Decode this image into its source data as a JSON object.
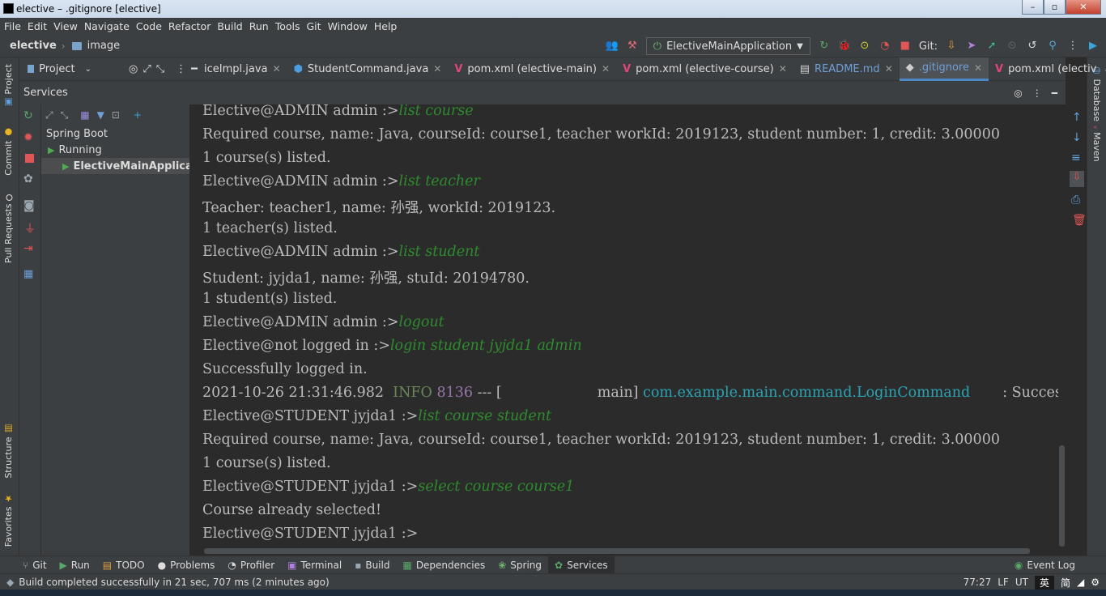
{
  "window": {
    "title": "elective – .gitignore [elective]",
    "min": "–",
    "max": "▫",
    "close": "✕"
  },
  "menu": [
    "File",
    "Edit",
    "View",
    "Navigate",
    "Code",
    "Refactor",
    "Build",
    "Run",
    "Tools",
    "Git",
    "Window",
    "Help"
  ],
  "breadcrumb": {
    "project": "elective",
    "folder": "image"
  },
  "run_config": {
    "label": "ElectiveMainApplication"
  },
  "git_label": "Git:",
  "project_tab": {
    "label": "Project"
  },
  "editor_tabs": [
    {
      "label": "iceImpl.java",
      "icon": "java-class-icon",
      "active": false
    },
    {
      "label": "StudentCommand.java",
      "icon": "java-class-icon",
      "active": false
    },
    {
      "label": "pom.xml (elective-main)",
      "icon": "maven-icon",
      "active": false
    },
    {
      "label": "pom.xml (elective-course)",
      "icon": "maven-icon",
      "active": false
    },
    {
      "label": "README.md",
      "icon": "markdown-icon",
      "active": false
    },
    {
      "label": ".gitignore",
      "icon": "gitignore-icon",
      "active": true
    },
    {
      "label": "pom.xml (electiv",
      "icon": "maven-icon",
      "active": false
    }
  ],
  "left_strip": {
    "project": "Project",
    "commit": "Commit",
    "pull_requests": "Pull Requests",
    "structure": "Structure",
    "favorites": "Favorites"
  },
  "right_strip": {
    "database": "Database",
    "maven": "Maven"
  },
  "services": {
    "title": "Services",
    "tree": [
      {
        "label": "Spring Boot",
        "level": 0
      },
      {
        "label": "Running",
        "level": 1
      },
      {
        "label": "ElectiveMainApplicatio",
        "level": 2,
        "selected": true
      }
    ]
  },
  "console": {
    "lines": [
      {
        "prompt": "Elective@ADMIN admin :>",
        "cmd": "list course"
      },
      {
        "text": "Required course, name: Java, courseId: course1, teacher workId: 2019123, student number: 1, credit: 3.00000"
      },
      {
        "text": "1 course(s) listed."
      },
      {
        "prompt": "Elective@ADMIN admin :>",
        "cmd": "list teacher"
      },
      {
        "text": "Teacher: teacher1, name: 孙强, workId: 2019123."
      },
      {
        "text": "1 teacher(s) listed."
      },
      {
        "prompt": "Elective@ADMIN admin :>",
        "cmd": "list student"
      },
      {
        "text": "Student: jyjda1, name: 孙强, stuId: 20194780."
      },
      {
        "text": "1 student(s) listed."
      },
      {
        "prompt": "Elective@ADMIN admin :>",
        "cmd": "logout"
      },
      {
        "prompt": "Elective@not logged in :>",
        "cmd": "login student jyjda1 admin"
      },
      {
        "text": "Successfully logged in."
      },
      {
        "log": true,
        "ts": "2021-10-26 21:31:46.982",
        "level": "INFO",
        "pid": "8136",
        "sep": "--- [",
        "thread": "main]",
        "logger": "com.example.main.command.LoginCommand",
        "msg": ": Success"
      },
      {
        "prompt": "Elective@STUDENT jyjda1 :>",
        "cmd": "list course student"
      },
      {
        "text": "Required course, name: Java, courseId: course1, teacher workId: 2019123, student number: 1, credit: 3.00000"
      },
      {
        "text": "1 course(s) listed."
      },
      {
        "prompt": "Elective@STUDENT jyjda1 :>",
        "cmd": "select course course1"
      },
      {
        "text": "Course already selected!"
      },
      {
        "prompt": "Elective@STUDENT jyjda1 :>",
        "cmd": ""
      }
    ]
  },
  "bottom_tabs": [
    {
      "label": "Git",
      "icon": "git-branch-icon"
    },
    {
      "label": "Run",
      "icon": "run-icon"
    },
    {
      "label": "TODO",
      "icon": "todo-icon"
    },
    {
      "label": "Problems",
      "icon": "problems-icon"
    },
    {
      "label": "Profiler",
      "icon": "profiler-icon"
    },
    {
      "label": "Terminal",
      "icon": "terminal-icon"
    },
    {
      "label": "Build",
      "icon": "build-icon"
    },
    {
      "label": "Dependencies",
      "icon": "dependencies-icon"
    },
    {
      "label": "Spring",
      "icon": "spring-icon"
    },
    {
      "label": "Services",
      "icon": "services-icon",
      "active": true
    }
  ],
  "event_log": "Event Log",
  "status": {
    "message": "Build completed successfully in 21 sec, 707 ms (2 minutes ago)",
    "position": "77:27",
    "line_sep": "LF",
    "encoding": "UT",
    "ime1": "英",
    "ime2": "简"
  }
}
